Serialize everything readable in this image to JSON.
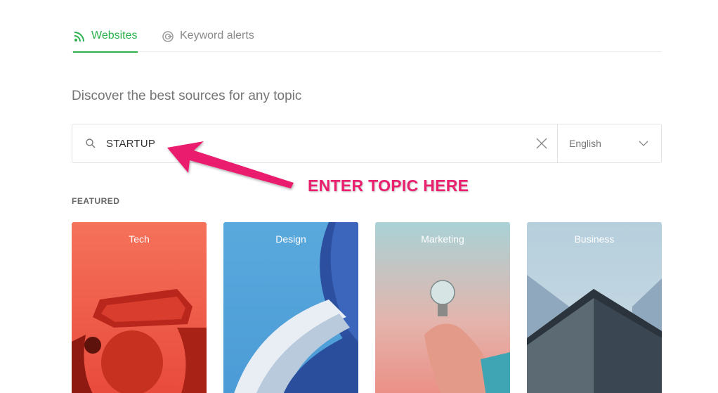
{
  "tabs": {
    "websites": {
      "label": "Websites",
      "icon": "rss-icon",
      "active": true
    },
    "keyword_alerts": {
      "label": "Keyword alerts",
      "icon": "google-icon",
      "active": false
    }
  },
  "headline": "Discover the best sources for any topic",
  "search": {
    "value": "STARTUP",
    "language": "English"
  },
  "annotation": {
    "text": "ENTER TOPIC HERE",
    "color": "#ea1f6e"
  },
  "featured": {
    "label": "FEATURED",
    "cards": [
      {
        "label": "Tech"
      },
      {
        "label": "Design"
      },
      {
        "label": "Marketing"
      },
      {
        "label": "Business"
      }
    ]
  },
  "colors": {
    "accent": "#2bb24c",
    "muted_text": "#8a8a8a"
  }
}
